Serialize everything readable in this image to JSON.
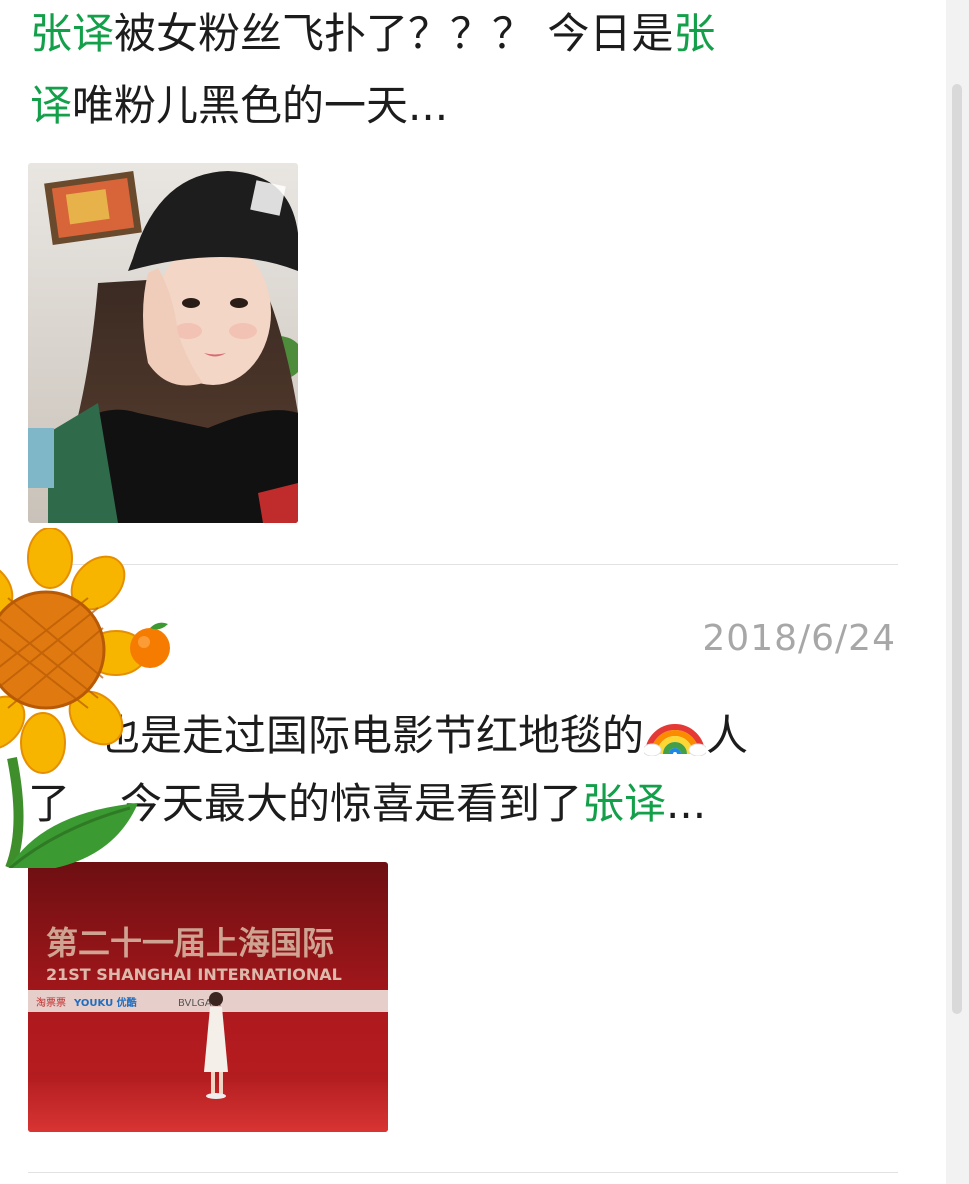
{
  "posts": [
    {
      "line1": {
        "p1_hl": "张译",
        "p2": "被女粉丝飞扑了？？？  今日是",
        "p3_hl": "张"
      },
      "line2": {
        "p1_hl": "译",
        "p2": "唯粉儿黑色的一天..."
      },
      "image_name": "selfie-photo"
    },
    {
      "date": "2018/6/24",
      "line1": {
        "p1": "也是走过国际电影节红地毯的",
        "p2": "人"
      },
      "line2": {
        "p1": "了",
        "p2": "今天最大的惊喜是看到了",
        "p3_hl": "张译",
        "p4": "..."
      },
      "image_name": "red-carpet-photo",
      "image_banner": {
        "cn": "第二十一届上海国际",
        "en": "21ST SHANGHAI INTERNATIONAL",
        "sponsors": [
          "淘票票",
          "YOUKU 优酷",
          "BVLGARI"
        ]
      }
    }
  ],
  "colors": {
    "highlight": "#14a04a",
    "text": "#1c1c1c",
    "date": "#a7a7a7",
    "divider": "#e2e2e2"
  },
  "icons": [
    "sunflower-sticker-icon",
    "orange-icon",
    "rainbow-icon"
  ]
}
